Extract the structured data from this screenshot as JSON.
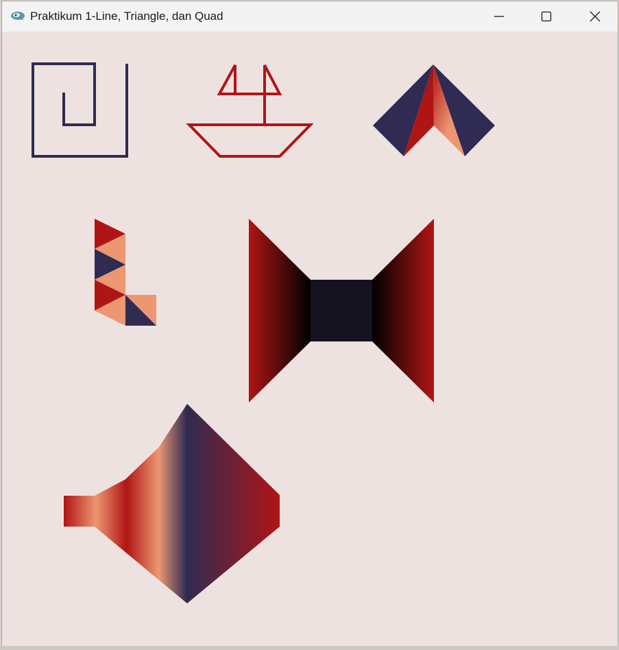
{
  "window": {
    "title": "Praktikum 1-Line, Triangle, dan Quad",
    "controls": {
      "minimize": "minimize-icon",
      "maximize": "maximize-icon",
      "close": "close-icon"
    }
  },
  "canvas": {
    "background": "#ede2df",
    "colors": {
      "navy": "#2f2b52",
      "red": "#b01515",
      "salmon": "#ec9772",
      "black": "#000000",
      "dark": "#15131f"
    },
    "shapes": [
      "spiral-lines",
      "boat-lines",
      "arrow-triangles",
      "l-triangles",
      "bowtie-quads",
      "funnel-quads"
    ]
  }
}
